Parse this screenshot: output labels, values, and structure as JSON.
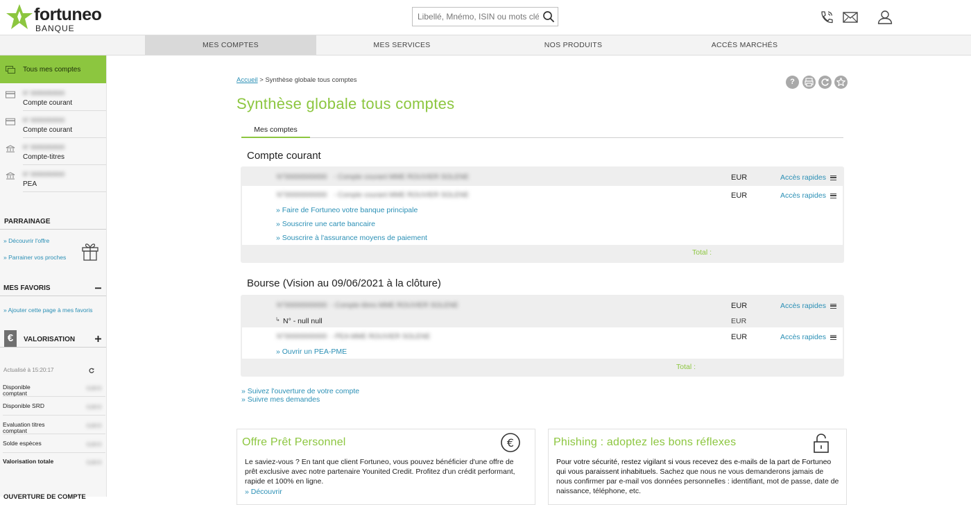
{
  "header": {
    "logo_word": "fortuneo",
    "logo_sub": "BANQUE",
    "search_placeholder": "Libellé, Mnémo, ISIN ou mots clés"
  },
  "nav": {
    "tabs": [
      {
        "label": "MES COMPTES",
        "active": true
      },
      {
        "label": "MES SERVICES"
      },
      {
        "label": "NOS PRODUITS"
      },
      {
        "label": "ACCÈS MARCHÉS"
      }
    ]
  },
  "sidebar": {
    "all_accounts": "Tous mes comptes",
    "accounts": [
      {
        "number": "N° 00000000000",
        "label": "Compte courant"
      },
      {
        "number": "N° 00000000000",
        "label": "Compte courant"
      },
      {
        "number": "N° 00000000000",
        "label": "Compte-titres"
      },
      {
        "number": "N° 00000000000",
        "label": "PEA"
      }
    ],
    "parrainage": {
      "title": "PARRAINAGE",
      "links": [
        "» Découvrir l'offre",
        "» Parrainer vos proches"
      ]
    },
    "favoris": {
      "title": "MES FAVORIS",
      "link": "» Ajouter cette page à mes favoris"
    },
    "valorisation": {
      "title": "VALORISATION",
      "updated": "Actualisé à 15:20:17",
      "rows": [
        {
          "label": "Disponible comptant",
          "value": "0,00 €"
        },
        {
          "label": "Disponible SRD",
          "value": "0,00 €"
        },
        {
          "label": "Evaluation titres comptant",
          "value": "0,00 €"
        },
        {
          "label": "Solde espèces",
          "value": "0,00 €"
        },
        {
          "label": "Valorisation totale",
          "value": "0,00 €",
          "bold": true
        }
      ]
    },
    "ouverture_title": "OUVERTURE DE COMPTE"
  },
  "main": {
    "breadcrumb_home": "Accueil",
    "breadcrumb_current": "> Synthèse globale tous comptes",
    "title": "Synthèse globale tous comptes",
    "tab": "Mes comptes",
    "compte_courant": {
      "title": "Compte courant",
      "rows": [
        {
          "number": "N°00000000000",
          "label": "- Compte courant MME ROUVIER SOLENE",
          "currency": "EUR",
          "quick": "Accès rapides"
        },
        {
          "number": "N°00000000000",
          "label": "- Compte courant MME ROUVIER SOLENE",
          "currency": "EUR",
          "quick": "Accès rapides"
        }
      ],
      "links": [
        "» Faire de Fortuneo votre banque principale",
        "» Souscrire une carte bancaire",
        "» Souscrire à l'assurance moyens de paiement"
      ],
      "total": "Total :"
    },
    "bourse": {
      "title": "Bourse (Vision au 09/06/2021 à la clôture)",
      "row1": {
        "number": "N°00000000000",
        "label": "- Compte-titres MME ROUVIER SOLENE",
        "currency": "EUR",
        "quick": "Accès rapides"
      },
      "sub_row": {
        "label": "N° - null null",
        "currency": "EUR"
      },
      "row2": {
        "number": "N°00000000000",
        "label": "- PEA MME ROUVIER SOLENE",
        "currency": "EUR",
        "quick": "Accès rapides"
      },
      "link": "» Ouvrir un PEA-PME",
      "total": "Total :"
    },
    "bottom_links": [
      "» Suivez l'ouverture de votre compte",
      "» Suivre mes demandes"
    ]
  },
  "cards": {
    "pret": {
      "title": "Offre Prêt Personnel",
      "text": "Le saviez-vous ? En tant que client Fortuneo, vous pouvez bénéficier d'une offre de prêt exclusive avec notre partenaire Younited Credit. Profitez d'un crédit performant, rapide et 100% en ligne.",
      "link": "» Découvrir"
    },
    "phishing": {
      "title": "Phishing : adoptez les bons réflexes",
      "text_bold": "Pour votre sécurité, restez vigilant si vous recevez des e-mails de la part de Fortuneo qui vous paraissent inhabituels.",
      "text": " Sachez que nous ne vous demanderons jamais de nous confirmer par e-mail vos données personnelles : identifiant, mot de passe, date de naissance, téléphone, etc."
    }
  },
  "colors": {
    "accent": "#8cc63f",
    "link": "#2a8fb5"
  }
}
